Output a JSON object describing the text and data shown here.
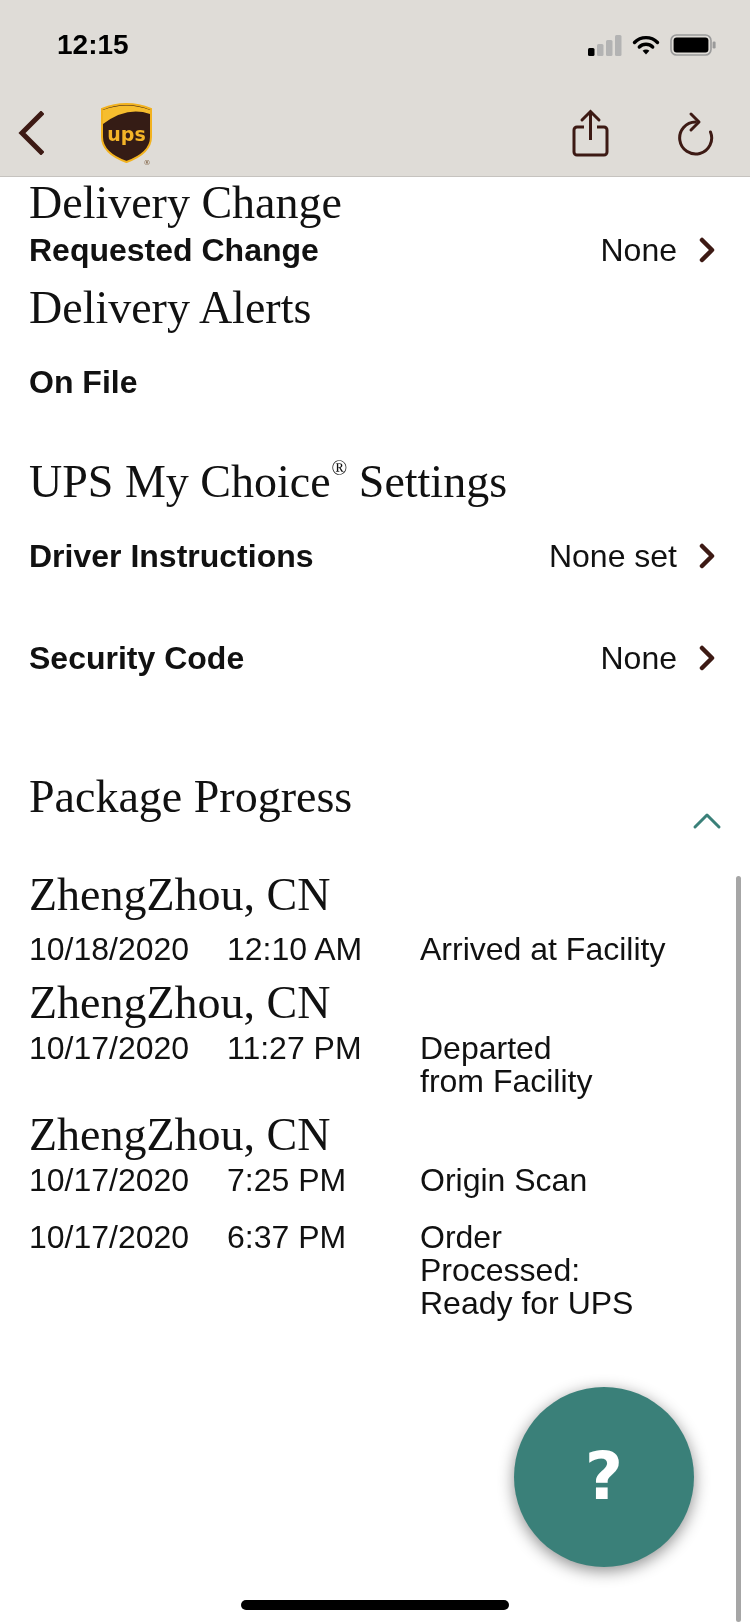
{
  "status_bar": {
    "time": "12:15"
  },
  "nav_bar": {
    "logo": {
      "text": "ups",
      "mark": "®"
    }
  },
  "sections": [
    {
      "title": "Delivery Change",
      "rows": [
        {
          "label": "Requested Change",
          "value": "None"
        }
      ]
    },
    {
      "title": "Delivery Alerts",
      "rows": [
        {
          "label": "On File"
        }
      ]
    },
    {
      "title": "UPS My Choice$^{®}$ Settings",
      "rows": [
        {
          "label": "Driver Instructions",
          "value": "None set"
        },
        {
          "label": "Security Code",
          "value": "None"
        }
      ]
    }
  ],
  "package_progress": {
    "title": "Package Progress",
    "expanded": true,
    "locations": [
      {
        "city": "ZhengZhou, CN",
        "events": [
          {
            "date": "10/18/2020",
            "time": "12:10 AM",
            "activity": "Arrived at Facility"
          }
        ]
      },
      {
        "city": "ZhengZhou, CN",
        "events": [
          {
            "date": "10/17/2020",
            "time": "11:27 PM",
            "activity": "Departed\nfrom Facility"
          }
        ]
      },
      {
        "city": "ZhengZhou, CN",
        "events": [
          {
            "date": "10/17/2020",
            "time": "7:25 PM",
            "activity": "Origin Scan"
          },
          {
            "date": "10/17/2020",
            "time": "6:37 PM",
            "activity": "Order\nProcessed:\nReady for UPS"
          }
        ]
      }
    ]
  },
  "help_button": {
    "label": "?"
  }
}
